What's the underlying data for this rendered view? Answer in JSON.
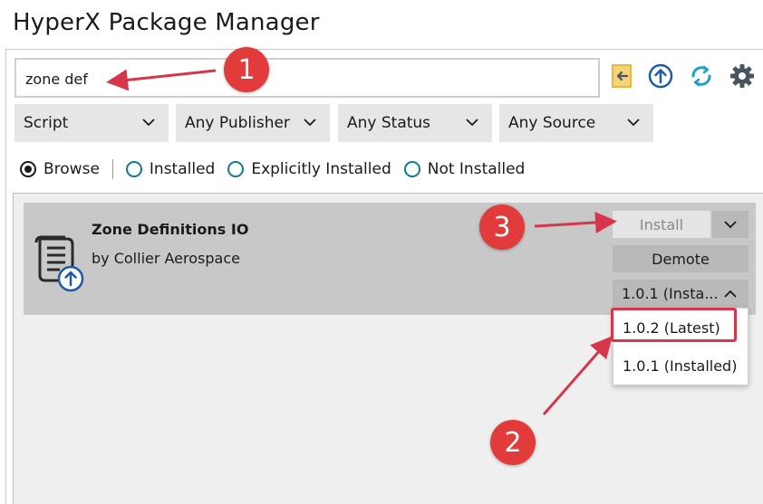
{
  "app": {
    "title": "HyperX Package Manager"
  },
  "search": {
    "value": "zone def",
    "placeholder": ""
  },
  "toolbar": {
    "icons": [
      "import-icon",
      "upload-icon",
      "refresh-icon",
      "gear-icon"
    ]
  },
  "filters": [
    {
      "label": "Script"
    },
    {
      "label": "Any Publisher"
    },
    {
      "label": "Any Status"
    },
    {
      "label": "Any Source"
    }
  ],
  "view_modes": [
    {
      "label": "Browse",
      "checked": true
    },
    {
      "label": "Installed",
      "checked": false
    },
    {
      "label": "Explicitly Installed",
      "checked": false
    },
    {
      "label": "Not Installed",
      "checked": false
    }
  ],
  "package": {
    "title": "Zone Definitions IO",
    "publisher": "by Collier Aerospace",
    "install_label": "Install",
    "demote_label": "Demote",
    "version_selected": "1.0.1 (Insta..."
  },
  "version_menu": [
    {
      "label": "1.0.2 (Latest)"
    },
    {
      "label": "1.0.1 (Installed)"
    }
  ],
  "callouts": [
    "1",
    "2",
    "3"
  ],
  "colors": {
    "accent": "#0f7a94",
    "icon_blue": "#1f5aa6",
    "refresh_teal": "#1aa3c9",
    "gear_gray": "#4a5560",
    "import_yellow": "#e8b83a",
    "callout_red": "#e23b3b",
    "highlight_red": "#d6354a"
  }
}
